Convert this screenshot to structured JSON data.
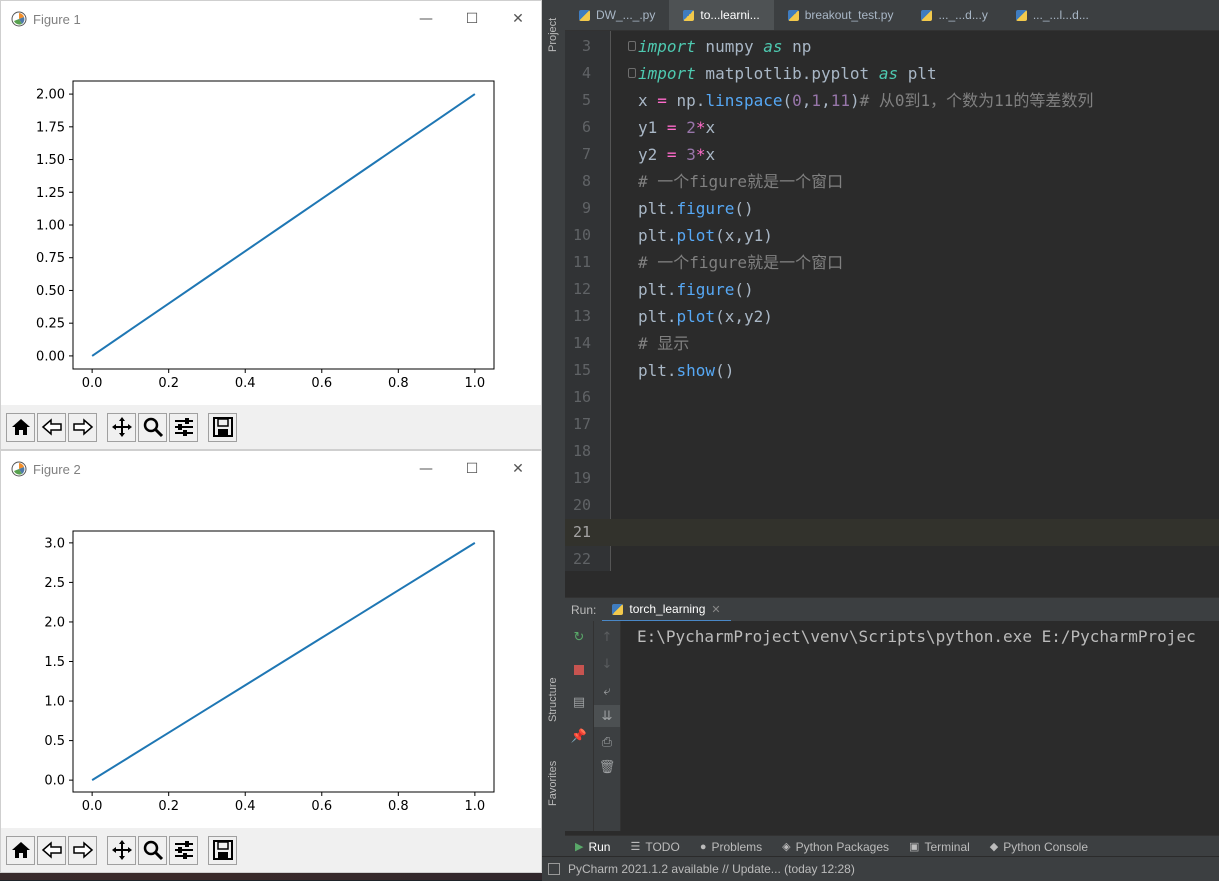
{
  "figures": [
    {
      "title": "Figure 1",
      "controls": {
        "minimize": "—",
        "maximize": "☐",
        "close": "✕"
      },
      "chart_data": {
        "type": "line",
        "x": [
          0.0,
          0.1,
          0.2,
          0.3,
          0.4,
          0.5,
          0.6,
          0.7,
          0.8,
          0.9,
          1.0
        ],
        "series": [
          {
            "values": [
              0.0,
              0.2,
              0.4,
              0.6,
              0.8,
              1.0,
              1.2,
              1.4,
              1.6,
              1.8,
              2.0
            ]
          }
        ],
        "xticks": [
          "0.0",
          "0.2",
          "0.4",
          "0.6",
          "0.8",
          "1.0"
        ],
        "yticks": [
          "0.00",
          "0.25",
          "0.50",
          "0.75",
          "1.00",
          "1.25",
          "1.50",
          "1.75",
          "2.00"
        ],
        "xlim": [
          -0.05,
          1.05
        ],
        "ylim": [
          -0.1,
          2.1
        ],
        "color": "#1f77b4"
      }
    },
    {
      "title": "Figure 2",
      "controls": {
        "minimize": "—",
        "maximize": "☐",
        "close": "✕"
      },
      "chart_data": {
        "type": "line",
        "x": [
          0.0,
          0.1,
          0.2,
          0.3,
          0.4,
          0.5,
          0.6,
          0.7,
          0.8,
          0.9,
          1.0
        ],
        "series": [
          {
            "values": [
              0.0,
              0.3,
              0.6,
              0.9,
              1.2,
              1.5,
              1.8,
              2.1,
              2.4,
              2.7,
              3.0
            ]
          }
        ],
        "xticks": [
          "0.0",
          "0.2",
          "0.4",
          "0.6",
          "0.8",
          "1.0"
        ],
        "yticks": [
          "0.0",
          "0.5",
          "1.0",
          "1.5",
          "2.0",
          "2.5",
          "3.0"
        ],
        "xlim": [
          -0.05,
          1.05
        ],
        "ylim": [
          -0.15,
          3.15
        ],
        "color": "#1f77b4"
      }
    }
  ],
  "toolbar_icons": [
    "home-icon",
    "back-icon",
    "forward-icon",
    "pan-icon",
    "zoom-icon",
    "configure-subplots-icon",
    "save-icon"
  ],
  "pycharm": {
    "side_tabs": {
      "project": "Project",
      "structure": "Structure",
      "favorites": "Favorites"
    },
    "editor_tabs": [
      "DW_..._.py",
      "to...learni...",
      "breakout_test.py",
      "..._...d...y",
      "..._...l...d..."
    ],
    "code_lines": [
      {
        "n": "3",
        "text": "import numpy as np"
      },
      {
        "n": "4",
        "text": "import matplotlib.pyplot as plt"
      },
      {
        "n": "5",
        "text": "x = np.linspace(0,1,11)# 从0到1，个数为11的等差数列"
      },
      {
        "n": "6",
        "text": "y1 = 2*x"
      },
      {
        "n": "7",
        "text": "y2 = 3*x"
      },
      {
        "n": "8",
        "text": "# 一个figure就是一个窗口"
      },
      {
        "n": "9",
        "text": "plt.figure()"
      },
      {
        "n": "10",
        "text": "plt.plot(x,y1)"
      },
      {
        "n": "11",
        "text": "# 一个figure就是一个窗口"
      },
      {
        "n": "12",
        "text": "plt.figure()"
      },
      {
        "n": "13",
        "text": "plt.plot(x,y2)"
      },
      {
        "n": "14",
        "text": "# 显示"
      },
      {
        "n": "15",
        "text": "plt.show()"
      },
      {
        "n": "16",
        "text": ""
      },
      {
        "n": "17",
        "text": ""
      },
      {
        "n": "18",
        "text": ""
      },
      {
        "n": "19",
        "text": ""
      },
      {
        "n": "20",
        "text": ""
      },
      {
        "n": "21",
        "text": ""
      },
      {
        "n": "22",
        "text": ""
      }
    ],
    "current_line": "21",
    "run": {
      "label": "Run:",
      "tab": "torch_learning",
      "close": "✕",
      "console": "E:\\PycharmProject\\venv\\Scripts\\python.exe E:/PycharmProjec"
    },
    "bottom_tabs": [
      {
        "label": "Run",
        "icon": "run-icon"
      },
      {
        "label": "TODO",
        "icon": "todo-icon"
      },
      {
        "label": "Problems",
        "icon": "problems-icon"
      },
      {
        "label": "Python Packages",
        "icon": "packages-icon"
      },
      {
        "label": "Terminal",
        "icon": "terminal-icon"
      },
      {
        "label": "Python Console",
        "icon": "python-console-icon"
      }
    ],
    "status": "PyCharm 2021.1.2 available // Update... (today 12:28)"
  }
}
